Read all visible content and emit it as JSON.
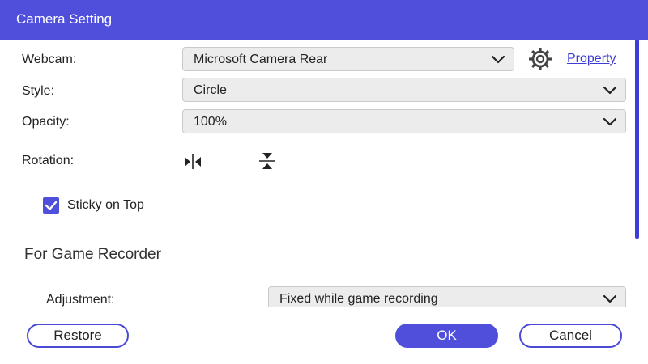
{
  "window": {
    "title": "Camera Setting"
  },
  "webcam": {
    "label": "Webcam:",
    "value": "Microsoft Camera Rear",
    "settings_icon": "gear-icon",
    "property_link": "Property"
  },
  "style": {
    "label": "Style:",
    "value": "Circle"
  },
  "opacity": {
    "label": "Opacity:",
    "value": "100%"
  },
  "rotation": {
    "label": "Rotation:",
    "icons": [
      "flip-horizontal-icon",
      "flip-vertical-icon"
    ]
  },
  "sticky": {
    "label": "Sticky on Top",
    "checked": true
  },
  "game_recorder": {
    "section_title": "For Game Recorder",
    "adjustment_label": "Adjustment:",
    "adjustment_value": "Fixed while game recording"
  },
  "footer": {
    "restore_label": "Restore",
    "ok_label": "OK",
    "cancel_label": "Cancel"
  },
  "colors": {
    "accent": "#4f4fdc",
    "link": "#3b3bd6",
    "field_bg": "#ececec"
  }
}
